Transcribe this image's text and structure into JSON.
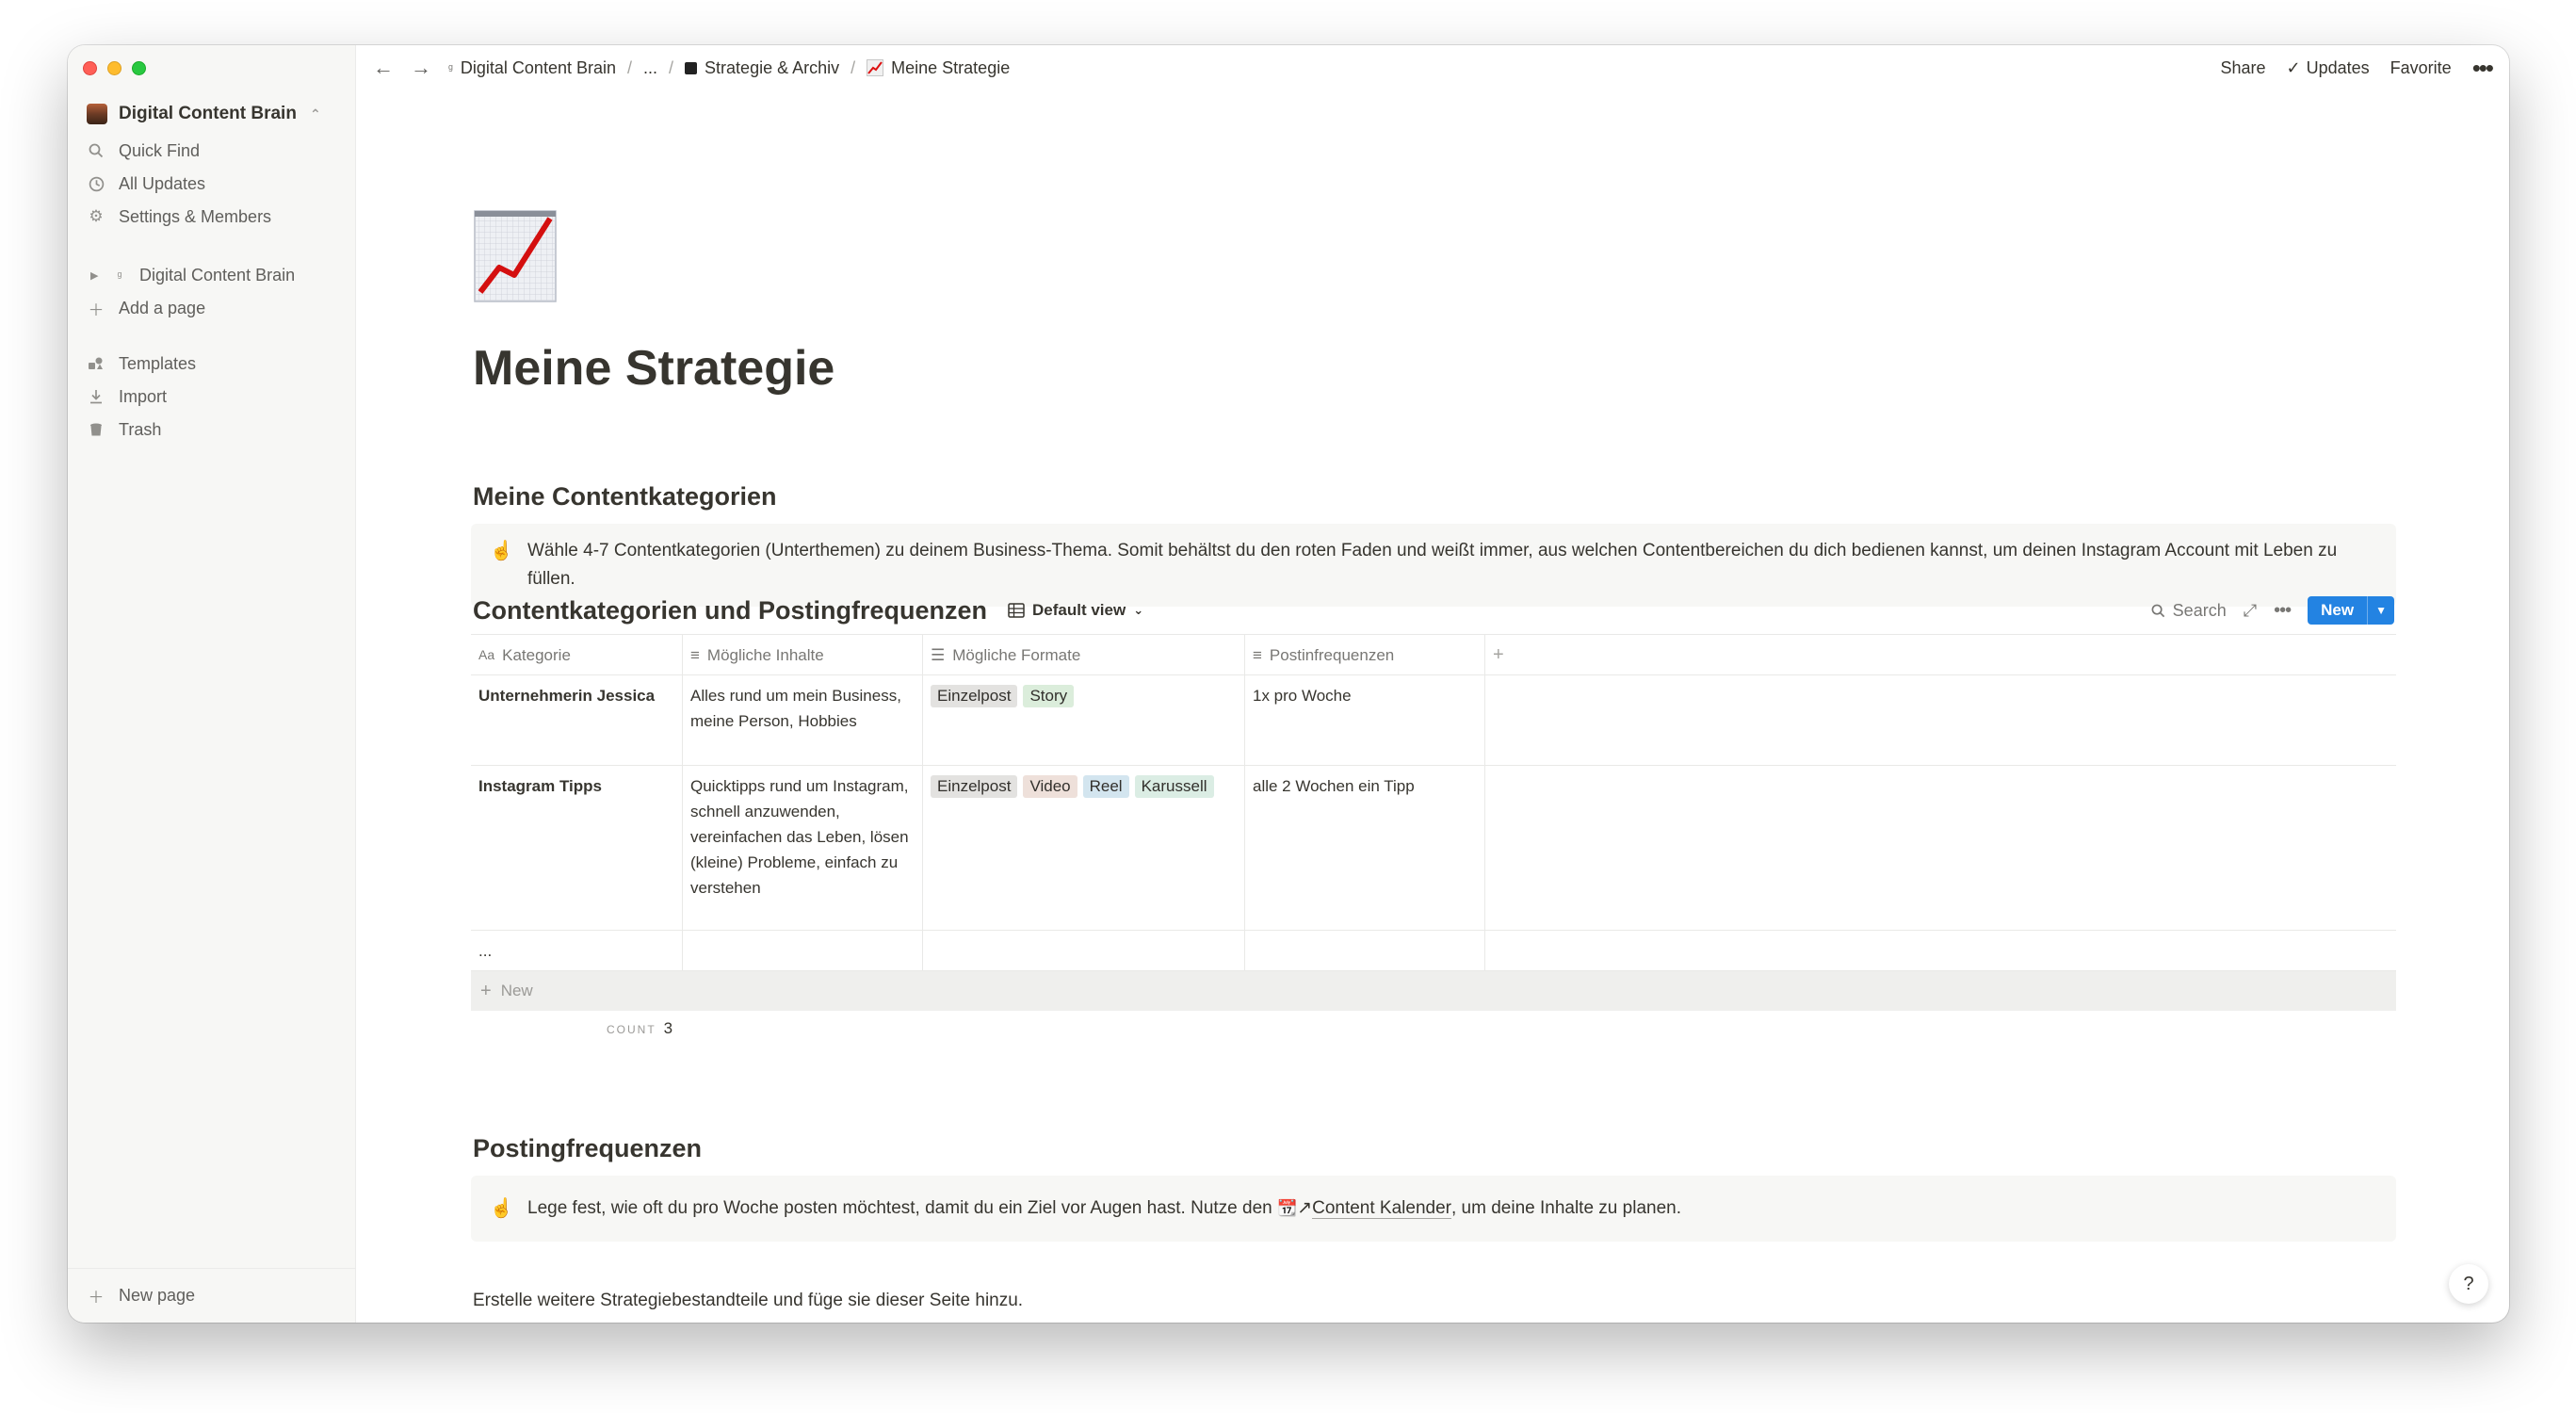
{
  "window": {
    "traffic_lights": [
      "close",
      "minimize",
      "zoom"
    ]
  },
  "sidebar": {
    "workspace": "Digital Content Brain",
    "nav": [
      {
        "label": "Quick Find",
        "icon": "search-icon"
      },
      {
        "label": "All Updates",
        "icon": "clock-icon"
      },
      {
        "label": "Settings & Members",
        "icon": "gear-icon"
      }
    ],
    "pages": [
      {
        "label": "Digital Content Brain"
      }
    ],
    "add_page": "Add a page",
    "tools": [
      {
        "label": "Templates",
        "icon": "templates-icon"
      },
      {
        "label": "Import",
        "icon": "import-icon"
      },
      {
        "label": "Trash",
        "icon": "trash-icon"
      }
    ],
    "new_page": "New page"
  },
  "topbar": {
    "breadcrumbs": [
      "Digital Content Brain",
      "...",
      "Strategie & Archiv",
      "Meine Strategie"
    ],
    "share": "Share",
    "updates": "Updates",
    "favorite": "Favorite"
  },
  "page": {
    "icon": "chart-increasing-icon",
    "title": "Meine Strategie",
    "section1_heading": "Meine Contentkategorien",
    "callout1_icon": "☝️",
    "callout1_text": "Wähle 4-7 Contentkategorien (Unterthemen) zu deinem Business-Thema. Somit behältst du den roten Faden und weißt immer, aus welchen Contentbereichen du dich bedienen kannst, um deinen Instagram Account mit Leben zu füllen.",
    "section2_heading": "Postingfrequenzen",
    "callout2_icon": "☝️",
    "callout2_before": "Lege fest, wie oft du pro Woche posten möchtest, damit du ein Ziel vor Augen hast. Nutze den ",
    "callout2_link": "Content Kalender",
    "callout2_after": ", um deine Inhalte zu planen.",
    "footer_text": "Erstelle weitere Strategiebestandteile und füge sie dieser Seite hinzu."
  },
  "database": {
    "title": "Contentkategorien und Postingfrequenzen",
    "view": "Default view",
    "search": "Search",
    "new_button": "New",
    "columns": [
      "Kategorie",
      "Mögliche Inhalte",
      "Mögliche Formate",
      "Postinfrequenzen"
    ],
    "rows": [
      {
        "kategorie": "Unternehmerin Jessica",
        "inhalte": "Alles rund um mein Business, meine Person, Hobbies",
        "formate": [
          "Einzelpost",
          "Story"
        ],
        "frequenz": "1x pro Woche"
      },
      {
        "kategorie": "Instagram Tipps",
        "inhalte": "Quicktipps rund um Instagram, schnell anzuwenden, vereinfachen das Leben, lösen (kleine) Probleme, einfach zu verstehen",
        "formate": [
          "Einzelpost",
          "Video",
          "Reel",
          "Karussell"
        ],
        "frequenz": "alle 2 Wochen ein Tipp"
      },
      {
        "kategorie": "...",
        "inhalte": "",
        "formate": [],
        "frequenz": ""
      }
    ],
    "add_row": "New",
    "count_label": "COUNT",
    "count_value": "3"
  },
  "colors": {
    "accent": "#2383e2",
    "sidebar_bg": "#f7f7f5",
    "text": "#37352f"
  }
}
